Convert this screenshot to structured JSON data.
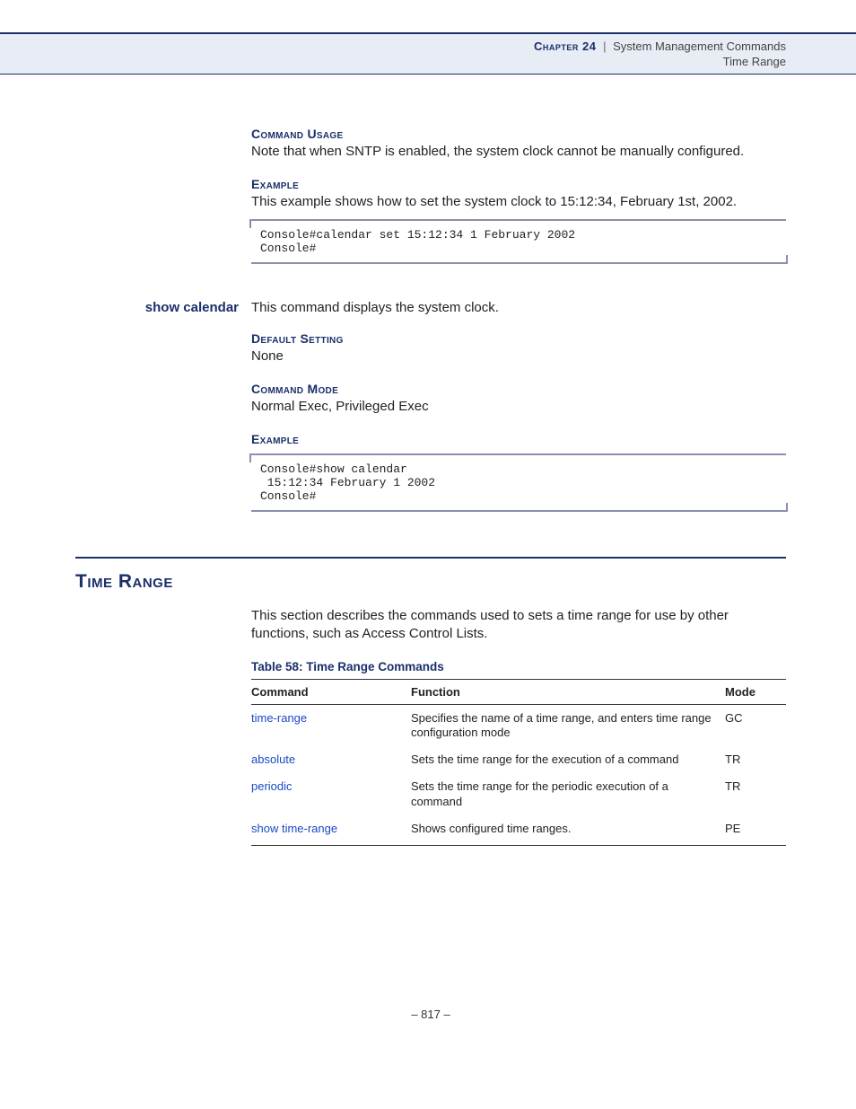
{
  "header": {
    "chapter_label": "Chapter 24",
    "crumb1": "System Management Commands",
    "crumb2": "Time Range"
  },
  "sec1": {
    "usage_label": "Command Usage",
    "usage_text": "Note that when SNTP is enabled, the system clock cannot be manually configured.",
    "example_label": "Example",
    "example_text": "This example shows how to set the system clock to 15:12:34, February 1st, 2002.",
    "code": "Console#calendar set 15:12:34 1 February 2002\nConsole#"
  },
  "cmd2": {
    "name": "show calendar",
    "desc": "This command displays the system clock.",
    "default_label": "Default Setting",
    "default_text": "None",
    "mode_label": "Command Mode",
    "mode_text": "Normal Exec, Privileged Exec",
    "example_label": "Example",
    "code": "Console#show calendar\n 15:12:34 February 1 2002\nConsole#"
  },
  "major": {
    "heading": "Time Range",
    "intro": "This section describes the commands used to sets a time range for use by other functions, such as Access Control Lists.",
    "table_caption": "Table 58: Time Range Commands"
  },
  "table": {
    "head": {
      "c1": "Command",
      "c2": "Function",
      "c3": "Mode"
    },
    "rows": [
      {
        "c1": "time-range",
        "c2": "Specifies the name of a time range, and enters time range configuration mode",
        "c3": "GC"
      },
      {
        "c1": "absolute",
        "c2": "Sets the time range for the execution of a command",
        "c3": "TR"
      },
      {
        "c1": "periodic",
        "c2": "Sets the time range for the periodic execution of a command",
        "c3": "TR"
      },
      {
        "c1": "show time-range",
        "c2": "Shows configured time ranges.",
        "c3": "PE"
      }
    ]
  },
  "page_number": "– 817 –"
}
